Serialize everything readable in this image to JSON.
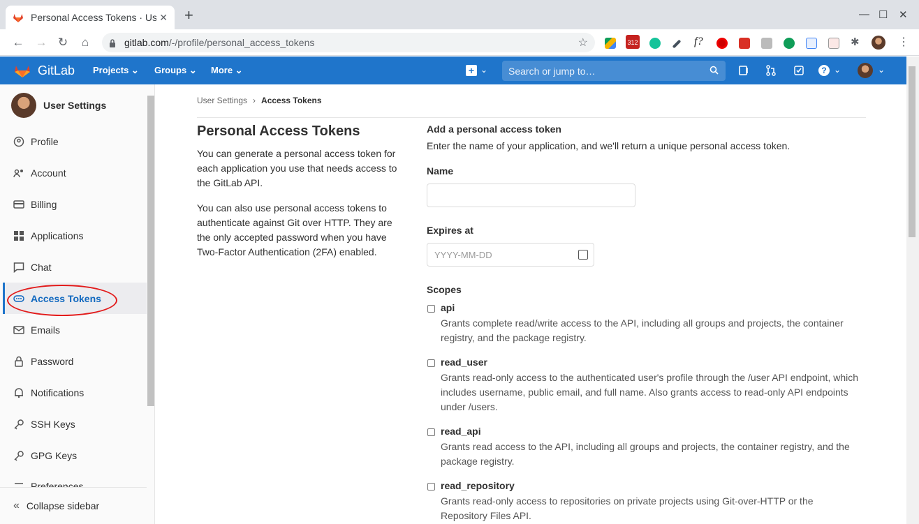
{
  "browser": {
    "tab_title": "Personal Access Tokens · User Settings · GitLab",
    "url_host": "gitlab.com",
    "url_path": "/-/profile/personal_access_tokens",
    "new_tab": "+",
    "badge_count": "312"
  },
  "header": {
    "brand": "GitLab",
    "menu": [
      "Projects",
      "Groups",
      "More"
    ],
    "search_placeholder": "Search or jump to…"
  },
  "sidebar": {
    "title": "User Settings",
    "items": [
      {
        "label": "Profile",
        "icon": "profile-icon"
      },
      {
        "label": "Account",
        "icon": "account-icon"
      },
      {
        "label": "Billing",
        "icon": "billing-icon"
      },
      {
        "label": "Applications",
        "icon": "applications-icon"
      },
      {
        "label": "Chat",
        "icon": "chat-icon"
      },
      {
        "label": "Access Tokens",
        "icon": "token-icon",
        "active": true
      },
      {
        "label": "Emails",
        "icon": "mail-icon"
      },
      {
        "label": "Password",
        "icon": "lock-icon"
      },
      {
        "label": "Notifications",
        "icon": "bell-icon"
      },
      {
        "label": "SSH Keys",
        "icon": "key-icon"
      },
      {
        "label": "GPG Keys",
        "icon": "key-icon"
      },
      {
        "label": "Preferences",
        "icon": "preferences-icon"
      }
    ],
    "collapse": "Collapse sidebar"
  },
  "breadcrumb": {
    "parent": "User Settings",
    "current": "Access Tokens"
  },
  "intro": {
    "title": "Personal Access Tokens",
    "p1": "You can generate a personal access token for each application you use that needs access to the GitLab API.",
    "p2": "You can also use personal access tokens to authenticate against Git over HTTP. They are the only accepted password when you have Two-Factor Authentication (2FA) enabled."
  },
  "form": {
    "heading": "Add a personal access token",
    "description": "Enter the name of your application, and we'll return a unique personal access token.",
    "name_label": "Name",
    "name_value": "",
    "expires_label": "Expires at",
    "expires_placeholder": "YYYY-MM-DD",
    "scopes_label": "Scopes",
    "scopes": [
      {
        "name": "api",
        "desc": "Grants complete read/write access to the API, including all groups and projects, the container registry, and the package registry."
      },
      {
        "name": "read_user",
        "desc": "Grants read-only access to the authenticated user's profile through the /user API endpoint, which includes username, public email, and full name. Also grants access to read-only API endpoints under /users."
      },
      {
        "name": "read_api",
        "desc": "Grants read access to the API, including all groups and projects, the container registry, and the package registry."
      },
      {
        "name": "read_repository",
        "desc": "Grants read-only access to repositories on private projects using Git-over-HTTP or the Repository Files API."
      }
    ]
  },
  "colors": {
    "gitlab_blue": "#1f75cb",
    "annotation_red": "#e21b1b"
  }
}
